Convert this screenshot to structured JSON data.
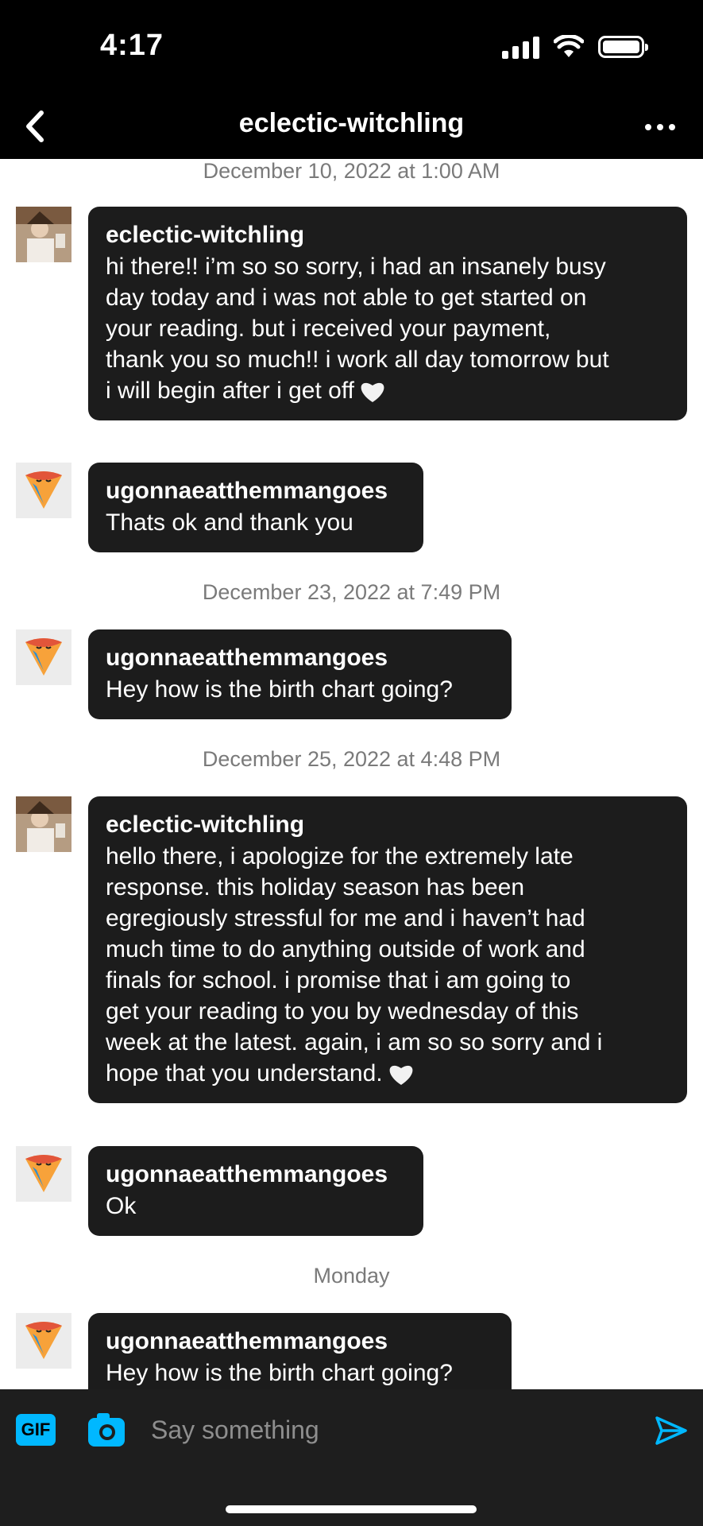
{
  "status_bar": {
    "time": "4:17"
  },
  "header": {
    "title": "eclectic-witchling",
    "back_icon": "chevron-left-icon",
    "more_icon": "more-horizontal-icon"
  },
  "messages": [
    {
      "type": "date",
      "text": "December 10, 2022 at 1:00 AM"
    },
    {
      "type": "message",
      "sender": "eclectic-witchling",
      "avatar": "witch-avatar",
      "lines": [
        "hi there!! i’m so so sorry, i had an insanely busy",
        "day today and i was not able to get started on",
        "your reading. but i received your payment,",
        "thank you so much!! i work all day tomorrow but",
        "i will begin after i get off"
      ],
      "emoji": "white-heart"
    },
    {
      "type": "message",
      "sender": "ugonnaeatthemmangoes",
      "avatar": "mango-avatar",
      "lines": [
        "Thats ok and thank you"
      ]
    },
    {
      "type": "date",
      "text": "December 23, 2022 at 7:49 PM"
    },
    {
      "type": "message",
      "sender": "ugonnaeatthemmangoes",
      "avatar": "mango-avatar",
      "lines": [
        "Hey how is the birth chart going?"
      ]
    },
    {
      "type": "date",
      "text": "December 25, 2022 at 4:48 PM"
    },
    {
      "type": "message",
      "sender": "eclectic-witchling",
      "avatar": "witch-avatar",
      "lines": [
        "hello there, i apologize for the extremely late",
        "response. this holiday season has been",
        "egregiously stressful for me and i haven’t had",
        "much time to do anything outside of work and",
        "finals for school. i promise that i am going to",
        "get your reading to you by wednesday of this",
        "week at the latest. again, i am so so sorry and i",
        "hope that you understand."
      ],
      "emoji": "white-heart"
    },
    {
      "type": "message",
      "sender": "ugonnaeatthemmangoes",
      "avatar": "mango-avatar",
      "lines": [
        "Ok"
      ]
    },
    {
      "type": "date",
      "text": "Monday"
    },
    {
      "type": "message",
      "sender": "ugonnaeatthemmangoes",
      "avatar": "mango-avatar",
      "lines": [
        "Hey how is the birth chart going?"
      ]
    }
  ],
  "composer": {
    "gif_label": "GIF",
    "placeholder": "Say something",
    "accent": "#00b8ff"
  }
}
